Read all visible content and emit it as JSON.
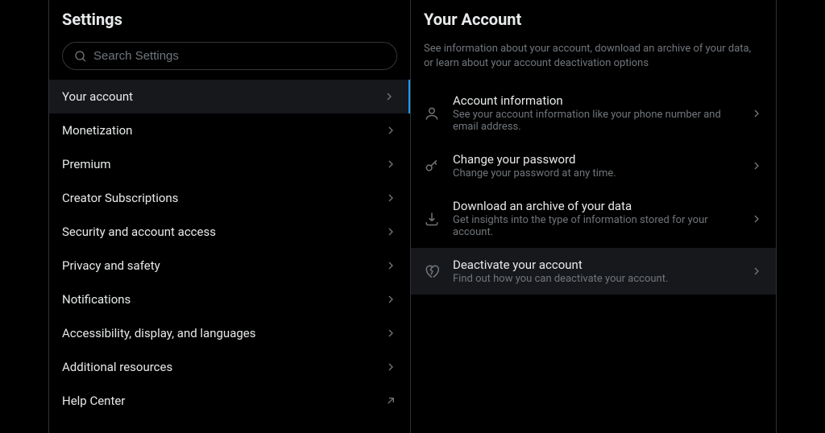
{
  "settings": {
    "title": "Settings",
    "search_placeholder": "Search Settings",
    "nav": [
      {
        "label": "Your account",
        "active": true,
        "external": false
      },
      {
        "label": "Monetization",
        "active": false,
        "external": false
      },
      {
        "label": "Premium",
        "active": false,
        "external": false
      },
      {
        "label": "Creator Subscriptions",
        "active": false,
        "external": false
      },
      {
        "label": "Security and account access",
        "active": false,
        "external": false
      },
      {
        "label": "Privacy and safety",
        "active": false,
        "external": false
      },
      {
        "label": "Notifications",
        "active": false,
        "external": false
      },
      {
        "label": "Accessibility, display, and languages",
        "active": false,
        "external": false
      },
      {
        "label": "Additional resources",
        "active": false,
        "external": false
      },
      {
        "label": "Help Center",
        "active": false,
        "external": true
      }
    ]
  },
  "account": {
    "title": "Your Account",
    "description": "See information about your account, download an archive of your data, or learn about your account deactivation options",
    "items": [
      {
        "icon": "person",
        "title": "Account information",
        "sub": "See your account information like your phone number and email address.",
        "highlighted": false
      },
      {
        "icon": "key",
        "title": "Change your password",
        "sub": "Change your password at any time.",
        "highlighted": false
      },
      {
        "icon": "download",
        "title": "Download an archive of your data",
        "sub": "Get insights into the type of information stored for your account.",
        "highlighted": false
      },
      {
        "icon": "heartbreak",
        "title": "Deactivate your account",
        "sub": "Find out how you can deactivate your account.",
        "highlighted": true
      }
    ]
  }
}
